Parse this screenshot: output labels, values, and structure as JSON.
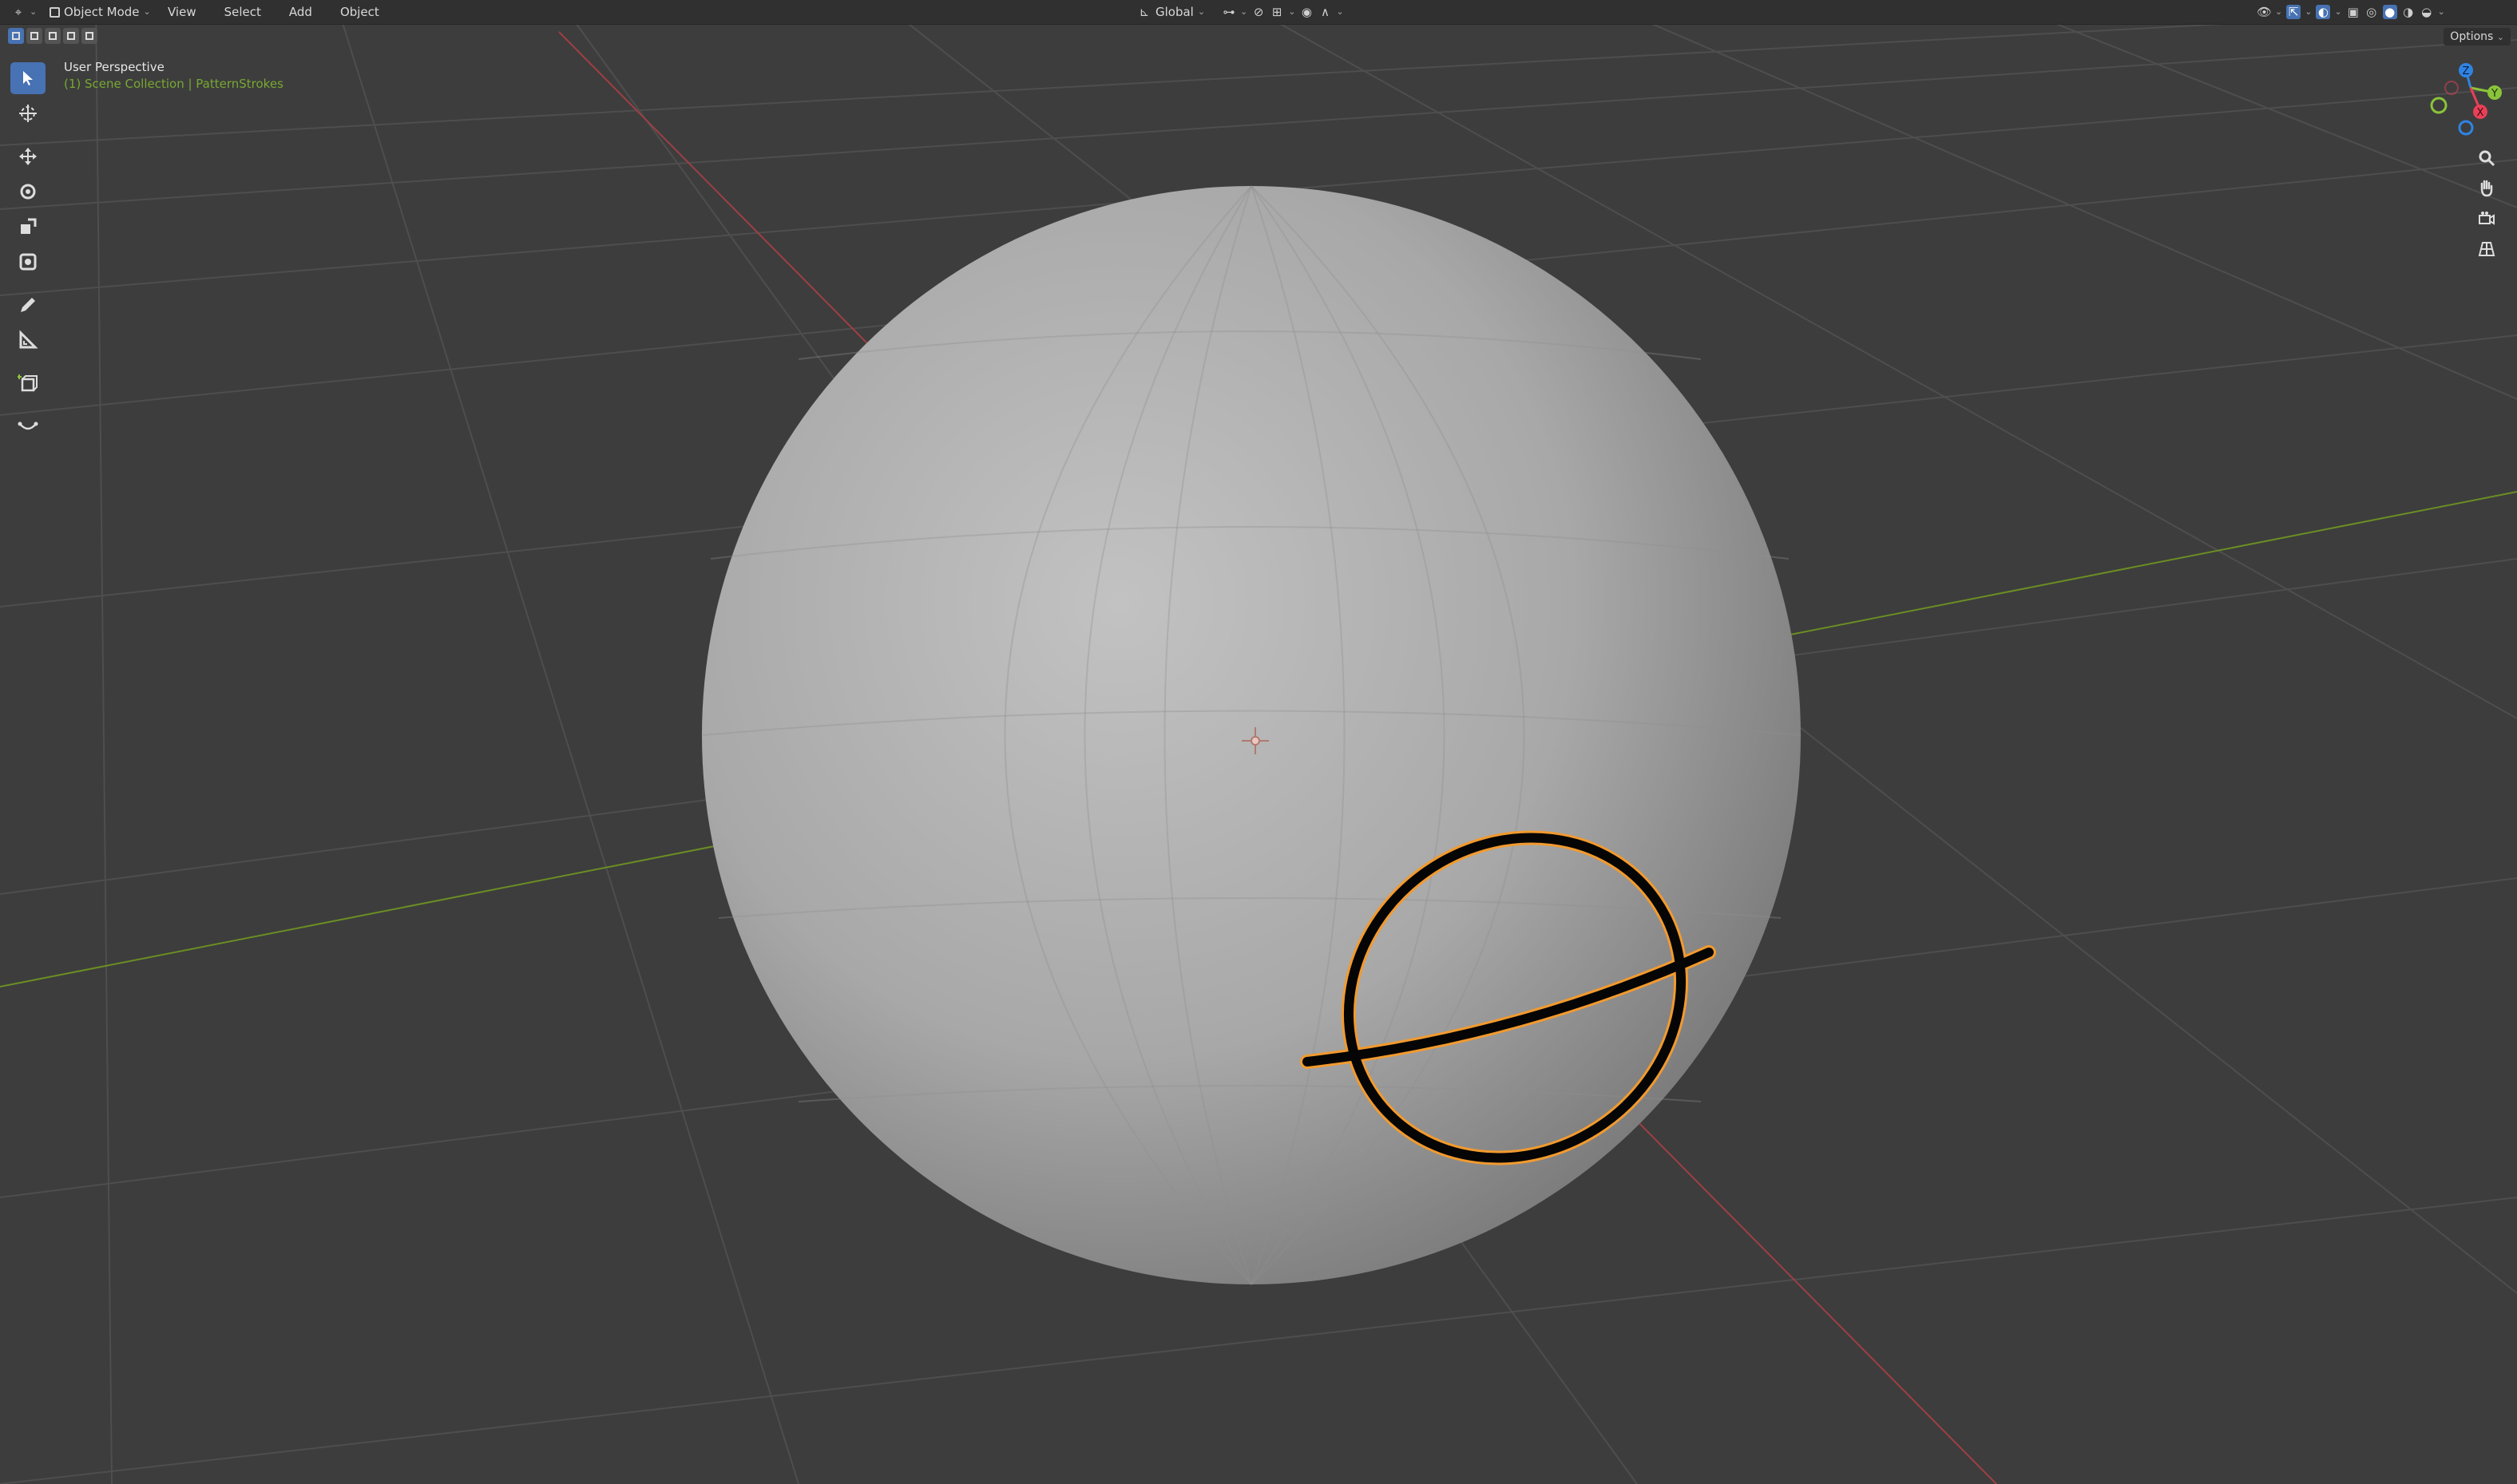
{
  "header": {
    "editor_type_icon": "3d-viewport-icon",
    "mode_label": "Object Mode",
    "menus": [
      "View",
      "Select",
      "Add",
      "Object"
    ],
    "transform_orientation": "Global"
  },
  "viewport": {
    "view_name": "User Perspective",
    "collection_path": "(1) Scene Collection | PatternStrokes",
    "options_label": "Options"
  },
  "toolbar": {
    "tools": [
      {
        "name": "select-box-tool",
        "icon": "cursor-arrow-icon",
        "active": true
      },
      {
        "name": "cursor-tool",
        "icon": "3d-cursor-icon",
        "active": false
      },
      {
        "name": "move-tool",
        "icon": "move-arrows-icon",
        "active": false
      },
      {
        "name": "rotate-tool",
        "icon": "rotate-icon",
        "active": false
      },
      {
        "name": "scale-tool",
        "icon": "scale-icon",
        "active": false
      },
      {
        "name": "transform-tool",
        "icon": "transform-icon",
        "active": false
      },
      {
        "name": "annotate-tool",
        "icon": "pencil-icon",
        "active": false
      },
      {
        "name": "measure-tool",
        "icon": "ruler-icon",
        "active": false
      },
      {
        "name": "add-cube-tool",
        "icon": "add-cube-icon",
        "active": false
      },
      {
        "name": "curve-tool",
        "icon": "curve-icon",
        "active": false
      }
    ]
  },
  "gizmo": {
    "axes": [
      "Z",
      "Y",
      "X"
    ],
    "colors": {
      "x": "#e84057",
      "y": "#8bc43a",
      "z": "#2f84e3"
    }
  },
  "colors": {
    "background": "#3d3d3d",
    "grid": "#4e4e4e",
    "x_axis": "#9e3f44",
    "y_axis": "#6b8e23",
    "selection_outline": "#f29a2e",
    "accent": "#4772b3"
  }
}
